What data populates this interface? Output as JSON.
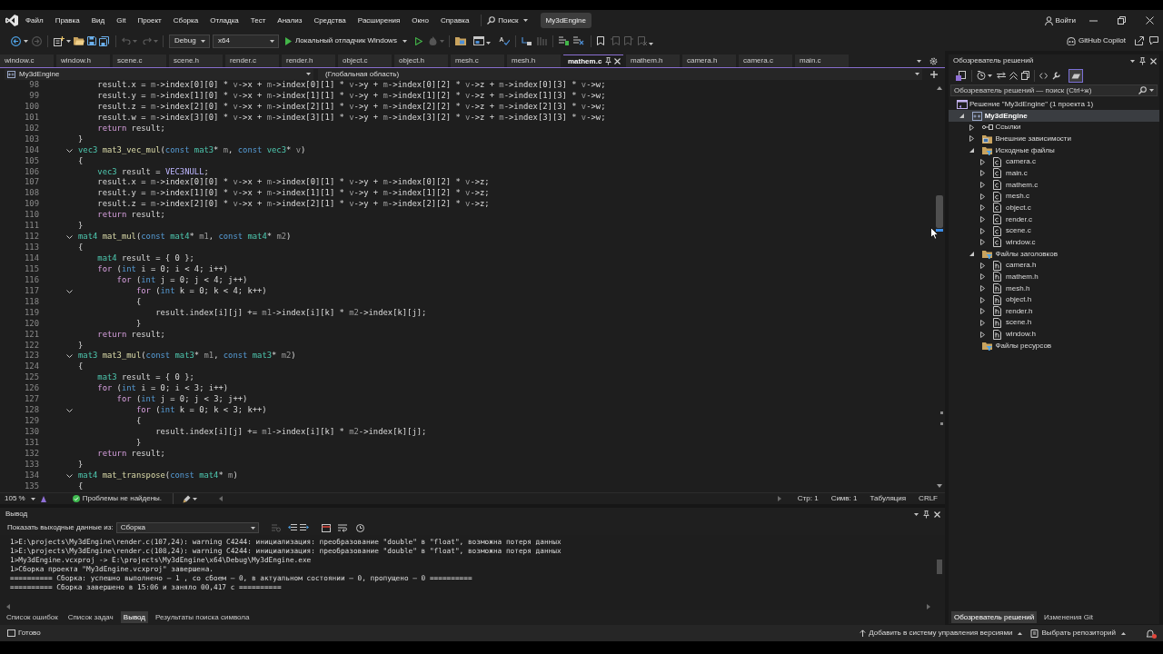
{
  "menu_bar": {
    "items": [
      "Файл",
      "Правка",
      "Вид",
      "Git",
      "Проект",
      "Сборка",
      "Отладка",
      "Тест",
      "Анализ",
      "Средства",
      "Расширения",
      "Окно",
      "Справка"
    ],
    "search": "Поиск",
    "solution_name": "My3dEngine",
    "sign_in": "Войти"
  },
  "toolbar": {
    "configuration": "Debug",
    "platform": "x64",
    "start_debugger": "Локальный отладчик Windows",
    "copilot": "GitHub Copilot"
  },
  "editor_tabs": [
    {
      "label": "window.c",
      "selected": false
    },
    {
      "label": "window.h",
      "selected": false
    },
    {
      "label": "scene.c",
      "selected": false
    },
    {
      "label": "scene.h",
      "selected": false
    },
    {
      "label": "render.c",
      "selected": false
    },
    {
      "label": "render.h",
      "selected": false
    },
    {
      "label": "object.c",
      "selected": false
    },
    {
      "label": "object.h",
      "selected": false
    },
    {
      "label": "mesh.c",
      "selected": false
    },
    {
      "label": "mesh.h",
      "selected": false
    },
    {
      "label": "mathem.c",
      "selected": true
    },
    {
      "label": "mathem.h",
      "selected": false
    },
    {
      "label": "camera.h",
      "selected": false
    },
    {
      "label": "camera.c",
      "selected": false
    },
    {
      "label": "main.c",
      "selected": false
    }
  ],
  "navigation_bar": {
    "project": "My3dEngine",
    "scope": "(Глобальная область)"
  },
  "editor": {
    "lines": [
      {
        "number": "98",
        "foldable": false,
        "tokens": [
          {
            "kind": "plain",
            "text": "    result.x = "
          },
          {
            "kind": "param",
            "text": "m"
          },
          {
            "kind": "plain",
            "text": "->index[0][0] * "
          },
          {
            "kind": "param",
            "text": "v"
          },
          {
            "kind": "plain",
            "text": "->x + "
          },
          {
            "kind": "param",
            "text": "m"
          },
          {
            "kind": "plain",
            "text": "->index[0][1] * "
          },
          {
            "kind": "param",
            "text": "v"
          },
          {
            "kind": "plain",
            "text": "->y + "
          },
          {
            "kind": "param",
            "text": "m"
          },
          {
            "kind": "plain",
            "text": "->index[0][2] * "
          },
          {
            "kind": "param",
            "text": "v"
          },
          {
            "kind": "plain",
            "text": "->z + "
          },
          {
            "kind": "param",
            "text": "m"
          },
          {
            "kind": "plain",
            "text": "->index[0][3] * "
          },
          {
            "kind": "param",
            "text": "v"
          },
          {
            "kind": "plain",
            "text": "->w;"
          }
        ]
      },
      {
        "number": "99",
        "foldable": false,
        "tokens": [
          {
            "kind": "plain",
            "text": "    result.y = "
          },
          {
            "kind": "param",
            "text": "m"
          },
          {
            "kind": "plain",
            "text": "->index[1][0] * "
          },
          {
            "kind": "param",
            "text": "v"
          },
          {
            "kind": "plain",
            "text": "->x + "
          },
          {
            "kind": "param",
            "text": "m"
          },
          {
            "kind": "plain",
            "text": "->index[1][1] * "
          },
          {
            "kind": "param",
            "text": "v"
          },
          {
            "kind": "plain",
            "text": "->y + "
          },
          {
            "kind": "param",
            "text": "m"
          },
          {
            "kind": "plain",
            "text": "->index[1][2] * "
          },
          {
            "kind": "param",
            "text": "v"
          },
          {
            "kind": "plain",
            "text": "->z + "
          },
          {
            "kind": "param",
            "text": "m"
          },
          {
            "kind": "plain",
            "text": "->index[1][3] * "
          },
          {
            "kind": "param",
            "text": "v"
          },
          {
            "kind": "plain",
            "text": "->w;"
          }
        ]
      },
      {
        "number": "100",
        "foldable": false,
        "tokens": [
          {
            "kind": "plain",
            "text": "    result.z = "
          },
          {
            "kind": "param",
            "text": "m"
          },
          {
            "kind": "plain",
            "text": "->index[2][0] * "
          },
          {
            "kind": "param",
            "text": "v"
          },
          {
            "kind": "plain",
            "text": "->x + "
          },
          {
            "kind": "param",
            "text": "m"
          },
          {
            "kind": "plain",
            "text": "->index[2][1] * "
          },
          {
            "kind": "param",
            "text": "v"
          },
          {
            "kind": "plain",
            "text": "->y + "
          },
          {
            "kind": "param",
            "text": "m"
          },
          {
            "kind": "plain",
            "text": "->index[2][2] * "
          },
          {
            "kind": "param",
            "text": "v"
          },
          {
            "kind": "plain",
            "text": "->z + "
          },
          {
            "kind": "param",
            "text": "m"
          },
          {
            "kind": "plain",
            "text": "->index[2][3] * "
          },
          {
            "kind": "param",
            "text": "v"
          },
          {
            "kind": "plain",
            "text": "->w;"
          }
        ]
      },
      {
        "number": "101",
        "foldable": false,
        "tokens": [
          {
            "kind": "plain",
            "text": "    result.w = "
          },
          {
            "kind": "param",
            "text": "m"
          },
          {
            "kind": "plain",
            "text": "->index[3][0] * "
          },
          {
            "kind": "param",
            "text": "v"
          },
          {
            "kind": "plain",
            "text": "->x + "
          },
          {
            "kind": "param",
            "text": "m"
          },
          {
            "kind": "plain",
            "text": "->index[3][1] * "
          },
          {
            "kind": "param",
            "text": "v"
          },
          {
            "kind": "plain",
            "text": "->y + "
          },
          {
            "kind": "param",
            "text": "m"
          },
          {
            "kind": "plain",
            "text": "->index[3][2] * "
          },
          {
            "kind": "param",
            "text": "v"
          },
          {
            "kind": "plain",
            "text": "->z + "
          },
          {
            "kind": "param",
            "text": "m"
          },
          {
            "kind": "plain",
            "text": "->index[3][3] * "
          },
          {
            "kind": "param",
            "text": "v"
          },
          {
            "kind": "plain",
            "text": "->w;"
          }
        ]
      },
      {
        "number": "102",
        "foldable": false,
        "tokens": [
          {
            "kind": "ctrl",
            "text": "    return"
          },
          {
            "kind": "plain",
            "text": " result;"
          }
        ]
      },
      {
        "number": "103",
        "foldable": false,
        "tokens": [
          {
            "kind": "plain",
            "text": "}"
          }
        ]
      },
      {
        "number": "104",
        "foldable": true,
        "tokens": [
          {
            "kind": "type",
            "text": "vec3"
          },
          {
            "kind": "func",
            "text": " mat3_vec_mul"
          },
          {
            "kind": "plain",
            "text": "("
          },
          {
            "kind": "kw",
            "text": "const"
          },
          {
            "kind": "type",
            "text": " mat3"
          },
          {
            "kind": "plain",
            "text": "* "
          },
          {
            "kind": "param",
            "text": "m"
          },
          {
            "kind": "plain",
            "text": ", "
          },
          {
            "kind": "kw",
            "text": "const"
          },
          {
            "kind": "type",
            "text": " vec3"
          },
          {
            "kind": "plain",
            "text": "* "
          },
          {
            "kind": "param",
            "text": "v"
          },
          {
            "kind": "plain",
            "text": ")"
          }
        ]
      },
      {
        "number": "105",
        "foldable": false,
        "tokens": [
          {
            "kind": "plain",
            "text": "{"
          }
        ]
      },
      {
        "number": "106",
        "foldable": false,
        "tokens": [
          {
            "kind": "type",
            "text": "    vec3"
          },
          {
            "kind": "plain",
            "text": " result = "
          },
          {
            "kind": "macro",
            "text": "VEC3NULL"
          },
          {
            "kind": "plain",
            "text": ";"
          }
        ]
      },
      {
        "number": "107",
        "foldable": false,
        "tokens": [
          {
            "kind": "plain",
            "text": "    result.x = "
          },
          {
            "kind": "param",
            "text": "m"
          },
          {
            "kind": "plain",
            "text": "->index[0][0] * "
          },
          {
            "kind": "param",
            "text": "v"
          },
          {
            "kind": "plain",
            "text": "->x + "
          },
          {
            "kind": "param",
            "text": "m"
          },
          {
            "kind": "plain",
            "text": "->index[0][1] * "
          },
          {
            "kind": "param",
            "text": "v"
          },
          {
            "kind": "plain",
            "text": "->y + "
          },
          {
            "kind": "param",
            "text": "m"
          },
          {
            "kind": "plain",
            "text": "->index[0][2] * "
          },
          {
            "kind": "param",
            "text": "v"
          },
          {
            "kind": "plain",
            "text": "->z;"
          }
        ]
      },
      {
        "number": "108",
        "foldable": false,
        "tokens": [
          {
            "kind": "plain",
            "text": "    result.y = "
          },
          {
            "kind": "param",
            "text": "m"
          },
          {
            "kind": "plain",
            "text": "->index[1][0] * "
          },
          {
            "kind": "param",
            "text": "v"
          },
          {
            "kind": "plain",
            "text": "->x + "
          },
          {
            "kind": "param",
            "text": "m"
          },
          {
            "kind": "plain",
            "text": "->index[1][1] * "
          },
          {
            "kind": "param",
            "text": "v"
          },
          {
            "kind": "plain",
            "text": "->y + "
          },
          {
            "kind": "param",
            "text": "m"
          },
          {
            "kind": "plain",
            "text": "->index[1][2] * "
          },
          {
            "kind": "param",
            "text": "v"
          },
          {
            "kind": "plain",
            "text": "->z;"
          }
        ]
      },
      {
        "number": "109",
        "foldable": false,
        "tokens": [
          {
            "kind": "plain",
            "text": "    result.z = "
          },
          {
            "kind": "param",
            "text": "m"
          },
          {
            "kind": "plain",
            "text": "->index[2][0] * "
          },
          {
            "kind": "param",
            "text": "v"
          },
          {
            "kind": "plain",
            "text": "->x + "
          },
          {
            "kind": "param",
            "text": "m"
          },
          {
            "kind": "plain",
            "text": "->index[2][1] * "
          },
          {
            "kind": "param",
            "text": "v"
          },
          {
            "kind": "plain",
            "text": "->y + "
          },
          {
            "kind": "param",
            "text": "m"
          },
          {
            "kind": "plain",
            "text": "->index[2][2] * "
          },
          {
            "kind": "param",
            "text": "v"
          },
          {
            "kind": "plain",
            "text": "->z;"
          }
        ]
      },
      {
        "number": "110",
        "foldable": false,
        "tokens": [
          {
            "kind": "ctrl",
            "text": "    return"
          },
          {
            "kind": "plain",
            "text": " result;"
          }
        ]
      },
      {
        "number": "111",
        "foldable": false,
        "tokens": [
          {
            "kind": "plain",
            "text": "}"
          }
        ]
      },
      {
        "number": "112",
        "foldable": true,
        "tokens": [
          {
            "kind": "type",
            "text": "mat4"
          },
          {
            "kind": "func",
            "text": " mat_mul"
          },
          {
            "kind": "plain",
            "text": "("
          },
          {
            "kind": "kw",
            "text": "const"
          },
          {
            "kind": "type",
            "text": " mat4"
          },
          {
            "kind": "plain",
            "text": "* "
          },
          {
            "kind": "param",
            "text": "m1"
          },
          {
            "kind": "plain",
            "text": ", "
          },
          {
            "kind": "kw",
            "text": "const"
          },
          {
            "kind": "type",
            "text": " mat4"
          },
          {
            "kind": "plain",
            "text": "* "
          },
          {
            "kind": "param",
            "text": "m2"
          },
          {
            "kind": "plain",
            "text": ")"
          }
        ]
      },
      {
        "number": "113",
        "foldable": false,
        "tokens": [
          {
            "kind": "plain",
            "text": "{"
          }
        ]
      },
      {
        "number": "114",
        "foldable": false,
        "tokens": [
          {
            "kind": "type",
            "text": "    mat4"
          },
          {
            "kind": "plain",
            "text": " result = { 0 };"
          }
        ]
      },
      {
        "number": "115",
        "foldable": false,
        "tokens": [
          {
            "kind": "ctrl",
            "text": "    for"
          },
          {
            "kind": "plain",
            "text": " ("
          },
          {
            "kind": "kw",
            "text": "int"
          },
          {
            "kind": "plain",
            "text": " i = 0; i < 4; i++)"
          }
        ]
      },
      {
        "number": "116",
        "foldable": false,
        "tokens": [
          {
            "kind": "ctrl",
            "text": "        for"
          },
          {
            "kind": "plain",
            "text": " ("
          },
          {
            "kind": "kw",
            "text": "int"
          },
          {
            "kind": "plain",
            "text": " j = 0; j < 4; j++)"
          }
        ]
      },
      {
        "number": "117",
        "foldable": true,
        "tokens": [
          {
            "kind": "ctrl",
            "text": "            for"
          },
          {
            "kind": "plain",
            "text": " ("
          },
          {
            "kind": "kw",
            "text": "int"
          },
          {
            "kind": "plain",
            "text": " k = 0; k < 4; k++)"
          }
        ]
      },
      {
        "number": "118",
        "foldable": false,
        "tokens": [
          {
            "kind": "plain",
            "text": "            {"
          }
        ]
      },
      {
        "number": "119",
        "foldable": false,
        "tokens": [
          {
            "kind": "plain",
            "text": "                result.index[i][j] += "
          },
          {
            "kind": "param",
            "text": "m1"
          },
          {
            "kind": "plain",
            "text": "->index[i][k] * "
          },
          {
            "kind": "param",
            "text": "m2"
          },
          {
            "kind": "plain",
            "text": "->index[k][j];"
          }
        ]
      },
      {
        "number": "120",
        "foldable": false,
        "tokens": [
          {
            "kind": "plain",
            "text": "            }"
          }
        ]
      },
      {
        "number": "121",
        "foldable": false,
        "tokens": [
          {
            "kind": "ctrl",
            "text": "    return"
          },
          {
            "kind": "plain",
            "text": " result;"
          }
        ]
      },
      {
        "number": "122",
        "foldable": false,
        "tokens": [
          {
            "kind": "plain",
            "text": "}"
          }
        ]
      },
      {
        "number": "123",
        "foldable": true,
        "tokens": [
          {
            "kind": "type",
            "text": "mat3"
          },
          {
            "kind": "func",
            "text": " mat3_mul"
          },
          {
            "kind": "plain",
            "text": "("
          },
          {
            "kind": "kw",
            "text": "const"
          },
          {
            "kind": "type",
            "text": " mat3"
          },
          {
            "kind": "plain",
            "text": "* "
          },
          {
            "kind": "param",
            "text": "m1"
          },
          {
            "kind": "plain",
            "text": ", "
          },
          {
            "kind": "kw",
            "text": "const"
          },
          {
            "kind": "type",
            "text": " mat3"
          },
          {
            "kind": "plain",
            "text": "* "
          },
          {
            "kind": "param",
            "text": "m2"
          },
          {
            "kind": "plain",
            "text": ")"
          }
        ]
      },
      {
        "number": "124",
        "foldable": false,
        "tokens": [
          {
            "kind": "plain",
            "text": "{"
          }
        ]
      },
      {
        "number": "125",
        "foldable": false,
        "tokens": [
          {
            "kind": "type",
            "text": "    mat3"
          },
          {
            "kind": "plain",
            "text": " result = { 0 };"
          }
        ]
      },
      {
        "number": "126",
        "foldable": false,
        "tokens": [
          {
            "kind": "ctrl",
            "text": "    for"
          },
          {
            "kind": "plain",
            "text": " ("
          },
          {
            "kind": "kw",
            "text": "int"
          },
          {
            "kind": "plain",
            "text": " i = 0; i < 3; i++)"
          }
        ]
      },
      {
        "number": "127",
        "foldable": false,
        "tokens": [
          {
            "kind": "ctrl",
            "text": "        for"
          },
          {
            "kind": "plain",
            "text": " ("
          },
          {
            "kind": "kw",
            "text": "int"
          },
          {
            "kind": "plain",
            "text": " j = 0; j < 3; j++)"
          }
        ]
      },
      {
        "number": "128",
        "foldable": true,
        "tokens": [
          {
            "kind": "ctrl",
            "text": "            for"
          },
          {
            "kind": "plain",
            "text": " ("
          },
          {
            "kind": "kw",
            "text": "int"
          },
          {
            "kind": "plain",
            "text": " k = 0; k < 3; k++)"
          }
        ]
      },
      {
        "number": "129",
        "foldable": false,
        "tokens": [
          {
            "kind": "plain",
            "text": "            {"
          }
        ]
      },
      {
        "number": "130",
        "foldable": false,
        "tokens": [
          {
            "kind": "plain",
            "text": "                result.index[i][j] += "
          },
          {
            "kind": "param",
            "text": "m1"
          },
          {
            "kind": "plain",
            "text": "->index[i][k] * "
          },
          {
            "kind": "param",
            "text": "m2"
          },
          {
            "kind": "plain",
            "text": "->index[k][j];"
          }
        ]
      },
      {
        "number": "131",
        "foldable": false,
        "tokens": [
          {
            "kind": "plain",
            "text": "            }"
          }
        ]
      },
      {
        "number": "132",
        "foldable": false,
        "tokens": [
          {
            "kind": "ctrl",
            "text": "    return"
          },
          {
            "kind": "plain",
            "text": " result;"
          }
        ]
      },
      {
        "number": "133",
        "foldable": false,
        "tokens": [
          {
            "kind": "plain",
            "text": "}"
          }
        ]
      },
      {
        "number": "134",
        "foldable": true,
        "tokens": [
          {
            "kind": "type",
            "text": "mat4"
          },
          {
            "kind": "func",
            "text": " mat_transpose"
          },
          {
            "kind": "plain",
            "text": "("
          },
          {
            "kind": "kw",
            "text": "const"
          },
          {
            "kind": "type",
            "text": " mat4"
          },
          {
            "kind": "plain",
            "text": "* "
          },
          {
            "kind": "param",
            "text": "m"
          },
          {
            "kind": "plain",
            "text": ")"
          }
        ]
      },
      {
        "number": "135",
        "foldable": false,
        "tokens": [
          {
            "kind": "plain",
            "text": "{"
          }
        ]
      }
    ]
  },
  "editor_status_bar": {
    "zoom": "105 %",
    "problems": "Проблемы не найдены.",
    "line": "Стр: 1",
    "column": "Симв: 1",
    "indentation": "Табуляция",
    "line_endings": "CRLF"
  },
  "output_panel": {
    "title": "Вывод",
    "source_label": "Показать выходные данные из:",
    "source": "Сборка",
    "lines": [
      "1>E:\\projects\\My3dEngine\\render.c(107,24): warning C4244: инициализация: преобразование \"double\" в \"float\", возможна потеря данных",
      "1>E:\\projects\\My3dEngine\\render.c(108,24): warning C4244: инициализация: преобразование \"double\" в \"float\", возможна потеря данных",
      "1>My3dEngine.vcxproj -> E:\\projects\\My3dEngine\\x64\\Debug\\My3dEngine.exe",
      "1>Сборка проекта \"My3dEngine.vcxproj\" завершена.",
      "========== Сборка: успешно выполнено — 1 , со сбоем — 0, в актуальном состоянии — 0, пропущено — 0 ==========",
      "========== Сборка завершено в 15:06 и заняло 00,417 с =========="
    ]
  },
  "bottom_tabs": [
    {
      "label": "Список ошибок",
      "selected": false
    },
    {
      "label": "Список задач",
      "selected": false
    },
    {
      "label": "Вывод",
      "selected": true
    },
    {
      "label": "Результаты поиска символа",
      "selected": false
    }
  ],
  "solution_explorer": {
    "title": "Обозреватель решений",
    "preview_toggle": {
      "on": true
    },
    "search_placeholder": "Обозреватель решений — поиск (Ctrl+ж)",
    "tree": [
      {
        "label": "Решение \"My3dEngine\" (1 проекта 1)",
        "kind": "solution",
        "expanded": true,
        "selected": false,
        "children": [
          {
            "label": "My3dEngine",
            "kind": "project",
            "expanded": true,
            "selected": true,
            "children": [
              {
                "label": "Ссылки",
                "kind": "references",
                "expanded": false,
                "selected": false
              },
              {
                "label": "Внешние зависимости",
                "kind": "dependencies",
                "expanded": false,
                "selected": false
              },
              {
                "label": "Исходные файлы",
                "kind": "folder",
                "expanded": true,
                "selected": false,
                "children": [
                  {
                    "label": "camera.c",
                    "kind": "source",
                    "expanded": false,
                    "selected": false
                  },
                  {
                    "label": "main.c",
                    "kind": "source",
                    "expanded": false,
                    "selected": false
                  },
                  {
                    "label": "mathem.c",
                    "kind": "source",
                    "expanded": false,
                    "selected": false
                  },
                  {
                    "label": "mesh.c",
                    "kind": "source",
                    "expanded": false,
                    "selected": false
                  },
                  {
                    "label": "object.c",
                    "kind": "source",
                    "expanded": false,
                    "selected": false
                  },
                  {
                    "label": "render.c",
                    "kind": "source",
                    "expanded": false,
                    "selected": false
                  },
                  {
                    "label": "scene.c",
                    "kind": "source",
                    "expanded": false,
                    "selected": false
                  },
                  {
                    "label": "window.c",
                    "kind": "source",
                    "expanded": false,
                    "selected": false
                  }
                ]
              },
              {
                "label": "Файлы заголовков",
                "kind": "folder",
                "expanded": true,
                "selected": false,
                "children": [
                  {
                    "label": "camera.h",
                    "kind": "header",
                    "expanded": false,
                    "selected": false
                  },
                  {
                    "label": "mathem.h",
                    "kind": "header",
                    "expanded": false,
                    "selected": false
                  },
                  {
                    "label": "mesh.h",
                    "kind": "header",
                    "expanded": false,
                    "selected": false
                  },
                  {
                    "label": "object.h",
                    "kind": "header",
                    "expanded": false,
                    "selected": false
                  },
                  {
                    "label": "render.h",
                    "kind": "header",
                    "expanded": false,
                    "selected": false
                  },
                  {
                    "label": "scene.h",
                    "kind": "header",
                    "expanded": false,
                    "selected": false
                  },
                  {
                    "label": "window.h",
                    "kind": "header",
                    "expanded": false,
                    "selected": false
                  }
                ]
              },
              {
                "label": "Файлы ресурсов",
                "kind": "empty_folder",
                "expanded": false,
                "selected": false
              }
            ]
          }
        ]
      }
    ]
  },
  "side_tabs": [
    {
      "label": "Обозреватель решений",
      "selected": true
    },
    {
      "label": "Изменения Git",
      "selected": false
    }
  ],
  "status_bar": {
    "status": "Готово",
    "source_control": "Добавить в систему управления версиями",
    "repository": "Выбрать репозиторий"
  }
}
